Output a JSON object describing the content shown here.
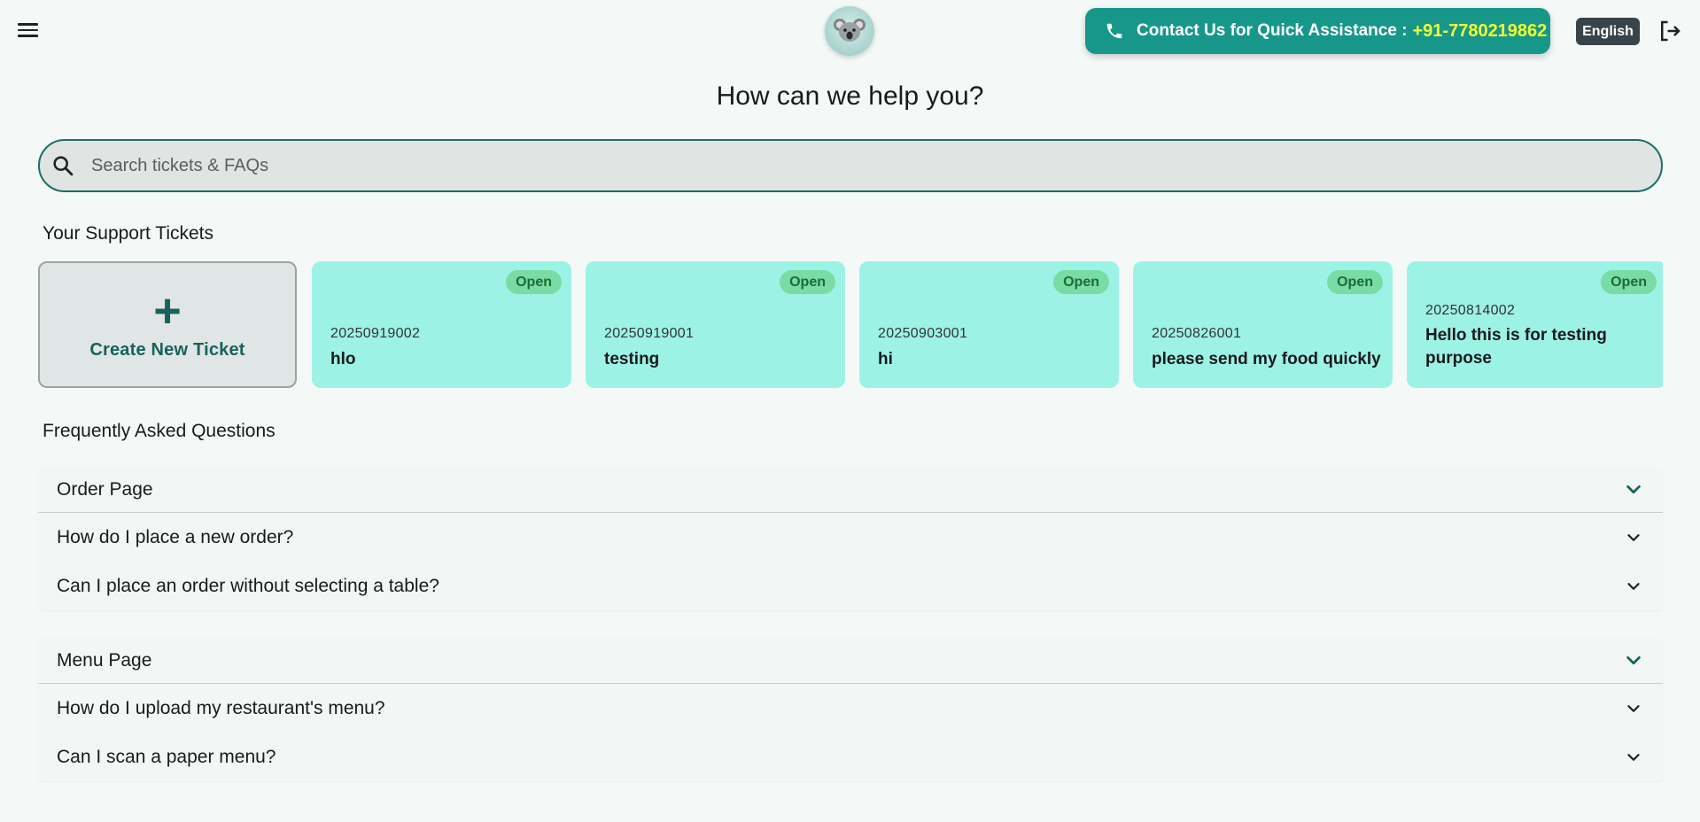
{
  "header": {
    "contact_label": "Contact Us for Quick Assistance :",
    "contact_number": "+91-7780219862",
    "language": "English"
  },
  "main": {
    "title": "How can we help you?",
    "search_placeholder": "Search tickets & FAQs"
  },
  "tickets": {
    "section_title": "Your Support Tickets",
    "create_label": "Create New Ticket",
    "items": [
      {
        "id": "20250919002",
        "subject": "hlo",
        "status": "Open"
      },
      {
        "id": "20250919001",
        "subject": "testing",
        "status": "Open"
      },
      {
        "id": "20250903001",
        "subject": "hi",
        "status": "Open"
      },
      {
        "id": "20250826001",
        "subject": "please send my food quickly",
        "status": "Open"
      },
      {
        "id": "20250814002",
        "subject": "Hello this is for testing purpose",
        "status": "Open"
      }
    ]
  },
  "faq": {
    "section_title": "Frequently Asked Questions",
    "groups": [
      {
        "title": "Order Page",
        "questions": [
          "How do I place a new order?",
          "Can I place an order without selecting a table?"
        ]
      },
      {
        "title": "Menu Page",
        "questions": [
          "How do I upload my restaurant's menu?",
          "Can I scan a paper menu?"
        ]
      }
    ]
  },
  "colors": {
    "accent": "#17978a",
    "ticket_bg": "#9df2e6",
    "badge_bg": "#79dca5",
    "highlight_number": "#f2ff2e"
  },
  "icons": {
    "menu": "hamburger-menu-icon",
    "logo": "koala-logo-icon",
    "phone": "phone-icon",
    "logout": "logout-icon",
    "search": "search-icon",
    "chevron": "chevron-down-icon",
    "plus": "plus-icon"
  }
}
